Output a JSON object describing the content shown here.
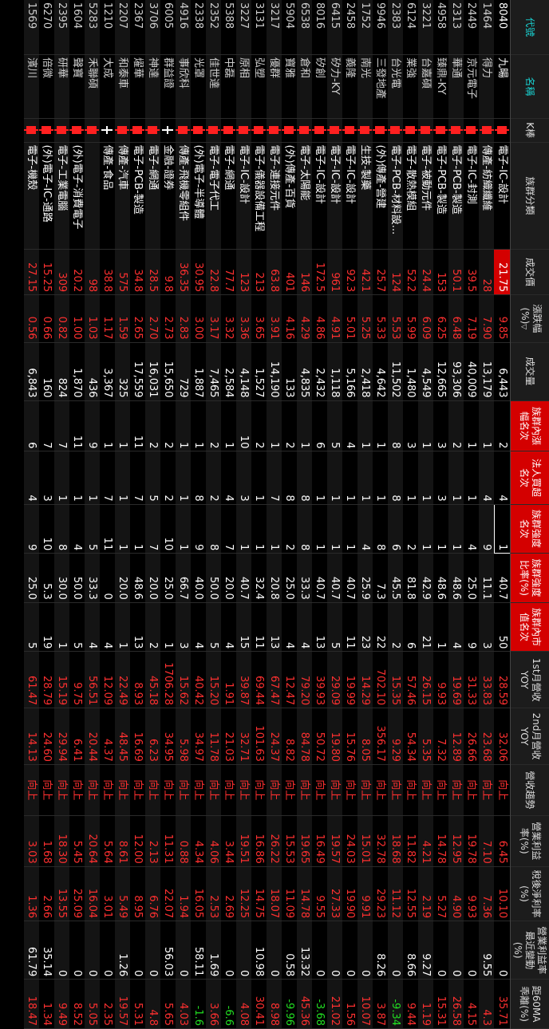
{
  "headers": {
    "code": "代號",
    "name": "名稱",
    "k": "K棒",
    "group": "族群分類",
    "price": "成交價",
    "change_pct": "漲跌幅(%)",
    "volume": "成交量",
    "group_rank_change": "族群內漲幅名次",
    "inst_buy_rank": "法人買超名次",
    "group_strength_rank": "族群強度名次",
    "group_strength_ratio": "族群強度比率(%)",
    "group_mktcap_rank": "族群內市值名次",
    "rev_yoy_1st": "1st月營收YOY",
    "rev_yoy_2nd": "2nd月營收YOY",
    "rev_trend": "營收趨勢",
    "op_margin": "營業利益率(%)",
    "net_margin": "稅後淨利率(%)",
    "op_margin_qoq": "營業利益率最近變動(%)",
    "ma60_dev": "距60MA乖離(%)"
  },
  "colors": {
    "accent": "#d40000",
    "up": "#ff3030",
    "down": "#22e022",
    "header_cyan": "#19d3d3"
  },
  "rows": [
    {
      "code": "8040",
      "name": "九暘",
      "k": "red",
      "group": "電子-IC-設計",
      "price": "21.75",
      "chg": "9.85",
      "vol": "6,443",
      "r1": "2",
      "r2": "4",
      "r3": "1",
      "ratio": "40.7",
      "r4": "50",
      "y1": "28.59",
      "y2": "32.06",
      "trend": "向上",
      "om": "6.45",
      "nm": "10.10",
      "omq": "0",
      "ma": "35.71",
      "selected": true
    },
    {
      "code": "1464",
      "name": "得力",
      "k": "red",
      "group": "傳產-紡織纖維",
      "price": "28",
      "chg": "7.90",
      "vol": "13,179",
      "r1": "1",
      "r2": "4",
      "r3": "9",
      "ratio": "11.1",
      "r4": "3",
      "y1": "33.83",
      "y2": "23.68",
      "trend": "向上",
      "om": "7.10",
      "nm": "7.36",
      "omq": "9.55",
      "ma": "4.3"
    },
    {
      "code": "2449",
      "name": "京元電子",
      "k": "red",
      "group": "電子-IC-封測",
      "price": "39.5",
      "chg": "7.19",
      "vol": "40,009",
      "r1": "1",
      "r2": "1",
      "r3": "4",
      "ratio": "25.0",
      "r4": "9",
      "y1": "31.33",
      "y2": "26.66",
      "trend": "向上",
      "om": "19.78",
      "nm": "9.93",
      "omq": "0",
      "ma": "4.15"
    },
    {
      "code": "2313",
      "name": "華通",
      "k": "red",
      "group": "電子-PCB-製造",
      "price": "50.1",
      "chg": "6.48",
      "vol": "93,306",
      "r1": "2",
      "r2": "1",
      "r3": "1",
      "ratio": "48.6",
      "r4": "4",
      "y1": "19.69",
      "y2": "12.89",
      "trend": "向上",
      "om": "12.95",
      "nm": "4.90",
      "omq": "0",
      "ma": "26.58"
    },
    {
      "code": "4958",
      "name": "臻鼎-KY",
      "k": "red",
      "group": "電子-PCB-製造",
      "price": "153",
      "chg": "6.25",
      "vol": "12,665",
      "r1": "3",
      "r2": "3",
      "r3": "1",
      "ratio": "48.6",
      "r4": "1",
      "y1": "9.93",
      "y2": "7.32",
      "trend": "向上",
      "om": "14.78",
      "nm": "5.27",
      "omq": "0",
      "ma": "15.31"
    },
    {
      "code": "3221",
      "name": "台嘉碩",
      "k": "red",
      "group": "電子-被動元件",
      "price": "24.4",
      "chg": "6.09",
      "vol": "4,549",
      "r1": "1",
      "r2": "1",
      "r3": "1",
      "ratio": "42.9",
      "r4": "21",
      "y1": "26.15",
      "y2": "5.35",
      "trend": "向上",
      "om": "4.21",
      "nm": "2.19",
      "omq": "9.27",
      "ma": "1.19"
    },
    {
      "code": "6124",
      "name": "業強",
      "k": "red",
      "group": "電子-散熱模組",
      "price": "52.2",
      "chg": "5.99",
      "vol": "1,480",
      "r1": "3",
      "r2": "1",
      "r3": "2",
      "ratio": "81.8",
      "r4": "6",
      "y1": "57.46",
      "y2": "54.34",
      "trend": "向上",
      "om": "11.82",
      "nm": "12.55",
      "omq": "8.66",
      "ma": "9.44"
    },
    {
      "code": "2383",
      "name": "台光電",
      "k": "red",
      "group": "電子-PCB-材料設...",
      "price": "124",
      "chg": "5.53",
      "vol": "11,502",
      "r1": "8",
      "r2": "8",
      "r3": "6",
      "ratio": "45.5",
      "r4": "2",
      "y1": "15.35",
      "y2": "9.29",
      "trend": "向上",
      "om": "18.68",
      "nm": "11.12",
      "omq": "0",
      "ma": "-9.34"
    },
    {
      "code": "9946",
      "name": "三發地產",
      "k": "red",
      "group": "(外)傳產-營建",
      "price": "25.7",
      "chg": "5.33",
      "vol": "4,642",
      "r1": "1",
      "r2": "1",
      "r3": "8",
      "ratio": "7.3",
      "r4": "22",
      "y1": "702.10",
      "y2": "356.17",
      "trend": "向上",
      "om": "32.78",
      "nm": "29.23",
      "omq": "8.26",
      "ma": "3.87"
    },
    {
      "code": "1752",
      "name": "南光",
      "k": "red",
      "group": "生技-製藥",
      "price": "42.1",
      "chg": "5.25",
      "vol": "2,418",
      "r1": "1",
      "r2": "1",
      "r3": "4",
      "ratio": "25.9",
      "r4": "23",
      "y1": "14.29",
      "y2": "8.05",
      "trend": "向上",
      "om": "15.01",
      "nm": "9.91",
      "omq": "0",
      "ma": "10.07"
    },
    {
      "code": "2458",
      "name": "義隆",
      "k": "red",
      "group": "電子-IC-設計",
      "price": "92.3",
      "chg": "5.01",
      "vol": "5,166",
      "r1": "4",
      "r2": "1",
      "r3": "1",
      "ratio": "40.7",
      "r4": "11",
      "y1": "19.99",
      "y2": "15.76",
      "trend": "向上",
      "om": "24.03",
      "nm": "19.90",
      "omq": "0",
      "ma": "1.56"
    },
    {
      "code": "6415",
      "name": "矽力-KY",
      "k": "red",
      "group": "電子-IC-設計",
      "price": "961",
      "chg": "4.91",
      "vol": "1,118",
      "r1": "5",
      "r2": "1",
      "r3": "1",
      "ratio": "40.7",
      "r4": "5",
      "y1": "29.09",
      "y2": "19.80",
      "trend": "向上",
      "om": "19.57",
      "nm": "27.33",
      "omq": "0",
      "ma": "21.02"
    },
    {
      "code": "8016",
      "name": "矽創",
      "k": "red",
      "group": "電子-IC-設計",
      "price": "172.5",
      "chg": "4.86",
      "vol": "2,432",
      "r1": "6",
      "r2": "1",
      "r3": "1",
      "ratio": "40.7",
      "r4": "13",
      "y1": "39.93",
      "y2": "50.72",
      "trend": "向上",
      "om": "16.49",
      "nm": "9.55",
      "omq": "0",
      "ma": "-3.68"
    },
    {
      "code": "6538",
      "name": "倉和",
      "k": "red",
      "group": "電子-太陽能",
      "price": "146",
      "chg": "4.29",
      "vol": "4,835",
      "r1": "1",
      "r2": "8",
      "r3": "8",
      "ratio": "33.3",
      "r4": "4",
      "y1": "79.20",
      "y2": "84.78",
      "trend": "向上",
      "om": "19.65",
      "nm": "14.78",
      "omq": "13.32",
      "ma": "45.36"
    },
    {
      "code": "5904",
      "name": "寶雅",
      "k": "red",
      "group": "(外)傳產-百貨",
      "price": "401",
      "chg": "4.16",
      "vol": "133",
      "r1": "2",
      "r2": "8",
      "r3": "2",
      "ratio": "25.0",
      "r4": "4",
      "y1": "12.47",
      "y2": "8.82",
      "trend": "向上",
      "om": "15.53",
      "nm": "11.09",
      "omq": "0.58",
      "ma": "-9.96"
    },
    {
      "code": "3217",
      "name": "優群",
      "k": "red",
      "group": "電子-連接元件",
      "price": "63.8",
      "chg": "3.91",
      "vol": "14,190",
      "r1": "1",
      "r2": "7",
      "r3": "1",
      "ratio": "20.8",
      "r4": "13",
      "y1": "67.47",
      "y2": "24.37",
      "trend": "向上",
      "om": "26.22",
      "nm": "18.07",
      "omq": "0",
      "ma": "8.98"
    },
    {
      "code": "3131",
      "name": "弘塑",
      "k": "red",
      "group": "電子-儀器設備工程",
      "price": "213",
      "chg": "3.65",
      "vol": "1,527",
      "r1": "2",
      "r2": "1",
      "r3": "1",
      "ratio": "32.4",
      "r4": "11",
      "y1": "69.44",
      "y2": "101.63",
      "trend": "向上",
      "om": "16.86",
      "nm": "14.75",
      "omq": "10.98",
      "ma": "30.41"
    },
    {
      "code": "3227",
      "name": "原相",
      "k": "red",
      "group": "電子-IC-設計",
      "price": "123",
      "chg": "3.36",
      "vol": "4,148",
      "r1": "10",
      "r2": "3",
      "r3": "1",
      "ratio": "40.7",
      "r4": "15",
      "y1": "39.87",
      "y2": "32.71",
      "trend": "向上",
      "om": "19.51",
      "nm": "12.25",
      "omq": "0",
      "ma": "4.08"
    },
    {
      "code": "5388",
      "name": "中磊",
      "k": "red",
      "group": "電子-網通",
      "price": "77.7",
      "chg": "3.32",
      "vol": "2,584",
      "r1": "1",
      "r2": "4",
      "r3": "7",
      "ratio": "20.0",
      "r4": "4",
      "y1": "1.91",
      "y2": "21.03",
      "trend": "向上",
      "om": "3.44",
      "nm": "2.69",
      "omq": "0",
      "ma": "-6.6"
    },
    {
      "code": "2352",
      "name": "佳世達",
      "k": "red",
      "group": "電子-電子代工",
      "price": "22.8",
      "chg": "3.17",
      "vol": "7,465",
      "r1": "2",
      "r2": "2",
      "r3": "8",
      "ratio": "50.0",
      "r4": "5",
      "y1": "15.20",
      "y2": "11.78",
      "trend": "向上",
      "om": "4.06",
      "nm": "2.53",
      "omq": "1.69",
      "ma": "3.66"
    },
    {
      "code": "2338",
      "name": "光罩",
      "k": "red",
      "group": "(外)電子-半導體",
      "price": "30.95",
      "chg": "3.00",
      "vol": "1,887",
      "r1": "1",
      "r2": "8",
      "r3": "9",
      "ratio": "40.0",
      "r4": "4",
      "y1": "40.42",
      "y2": "34.97",
      "trend": "向上",
      "om": "4.34",
      "nm": "16.05",
      "omq": "58.11",
      "ma": "-1.6"
    },
    {
      "code": "4916",
      "name": "事欣科",
      "k": "red",
      "group": "傳產-飛機零組件",
      "price": "36.35",
      "chg": "2.83",
      "vol": "729",
      "r1": "1",
      "r2": "1",
      "r3": "1",
      "ratio": "66.7",
      "r4": "3",
      "y1": "15.62",
      "y2": "5.98",
      "trend": "向上",
      "om": "0.88",
      "nm": "1.94",
      "omq": "0",
      "ma": "4.03"
    },
    {
      "code": "6005",
      "name": "群益證",
      "k": "white",
      "group": "金融-證券",
      "price": "9.8",
      "chg": "2.73",
      "vol": "15,650",
      "r1": "2",
      "r2": "2",
      "r3": "10",
      "ratio": "25.0",
      "r4": "1",
      "y1": "1706.28",
      "y2": "34.95",
      "trend": "向上",
      "om": "11.31",
      "nm": "22.07",
      "omq": "56.03",
      "ma": "5.65"
    },
    {
      "code": "3706",
      "name": "神達",
      "k": "red",
      "group": "電子-網通",
      "price": "28.5",
      "chg": "2.70",
      "vol": "16,031",
      "r1": "2",
      "r2": "5",
      "r3": "7",
      "ratio": "20.0",
      "r4": "2",
      "y1": "45.18",
      "y2": "6.23",
      "trend": "向上",
      "om": "2.13",
      "nm": "6.76",
      "omq": "0",
      "ma": "4.8"
    },
    {
      "code": "2367",
      "name": "燿華",
      "k": "red",
      "group": "電子-PCB-製造",
      "price": "34.8",
      "chg": "2.65",
      "vol": "17,559",
      "r1": "11",
      "r2": "7",
      "r3": "1",
      "ratio": "48.6",
      "r4": "13",
      "y1": "8.93",
      "y2": "16.69",
      "trend": "向上",
      "om": "12.00",
      "nm": "8.95",
      "omq": "0",
      "ma": "5.31"
    },
    {
      "code": "2207",
      "name": "和泰車",
      "k": "red",
      "group": "傳產-汽車",
      "price": "575",
      "chg": "1.59",
      "vol": "325",
      "r1": "1",
      "r2": "1",
      "r3": "1",
      "ratio": "20.0",
      "r4": "1",
      "y1": "22.49",
      "y2": "48.45",
      "trend": "向上",
      "om": "8.61",
      "nm": "5.49",
      "omq": "1.26",
      "ma": "19.57"
    },
    {
      "code": "1210",
      "name": "大成",
      "k": "white",
      "group": "傳產-食品",
      "price": "38.8",
      "chg": "1.17",
      "vol": "3,367",
      "r1": "1",
      "r2": "7",
      "r3": "11",
      "ratio": "0",
      "r4": "4",
      "y1": "12.09",
      "y2": "4.37",
      "trend": "向上",
      "om": "5.64",
      "nm": "3.01",
      "omq": "0",
      "ma": "2.35"
    },
    {
      "code": "5283",
      "name": "禾聯碩",
      "k": "red",
      "group": "",
      "price": "98",
      "chg": "1.03",
      "vol": "436",
      "r1": "9",
      "r2": "1",
      "r3": "5",
      "ratio": "33.3",
      "r4": "4",
      "y1": "56.51",
      "y2": "20.44",
      "trend": "向上",
      "om": "20.64",
      "nm": "16.04",
      "omq": "0",
      "ma": "5.05"
    },
    {
      "code": "1604",
      "name": "聲寶",
      "k": "red",
      "group": "(外)電子-消費電子",
      "price": "20.2",
      "chg": "1.00",
      "vol": "1,870",
      "r1": "11",
      "r2": "1",
      "r3": "4",
      "ratio": "50.0",
      "r4": "5",
      "y1": "9.75",
      "y2": "6.41",
      "trend": "向上",
      "om": "5.45",
      "nm": "25.09",
      "omq": "0",
      "ma": "8.52"
    },
    {
      "code": "2395",
      "name": "研華",
      "k": "red",
      "group": "電子-工業電腦",
      "price": "309",
      "chg": "0.82",
      "vol": "824",
      "r1": "7",
      "r2": "1",
      "r3": "8",
      "ratio": "30.0",
      "r4": "1",
      "y1": "15.19",
      "y2": "29.94",
      "trend": "向上",
      "om": "18.30",
      "nm": "13.55",
      "omq": "0",
      "ma": "9.49"
    },
    {
      "code": "6270",
      "name": "倍微",
      "k": "red",
      "group": "(外)電子-IC-通路",
      "price": "15.25",
      "chg": "0.66",
      "vol": "160",
      "r1": "7",
      "r2": "3",
      "r3": "10",
      "ratio": "5.3",
      "r4": "19",
      "y1": "28.79",
      "y2": "24.60",
      "trend": "向上",
      "om": "1.68",
      "nm": "2.66",
      "omq": "35.14",
      "ma": "1.34"
    },
    {
      "code": "1569",
      "name": "濱川",
      "k": "red",
      "group": "電子-機殼",
      "price": "27.15",
      "chg": "0.56",
      "vol": "6,843",
      "r1": "6",
      "r2": "4",
      "r3": "9",
      "ratio": "25.0",
      "r4": "5",
      "y1": "61.47",
      "y2": "14.13",
      "trend": "向上",
      "om": "3.03",
      "nm": "1.36",
      "omq": "61.79",
      "ma": "18.47"
    }
  ]
}
